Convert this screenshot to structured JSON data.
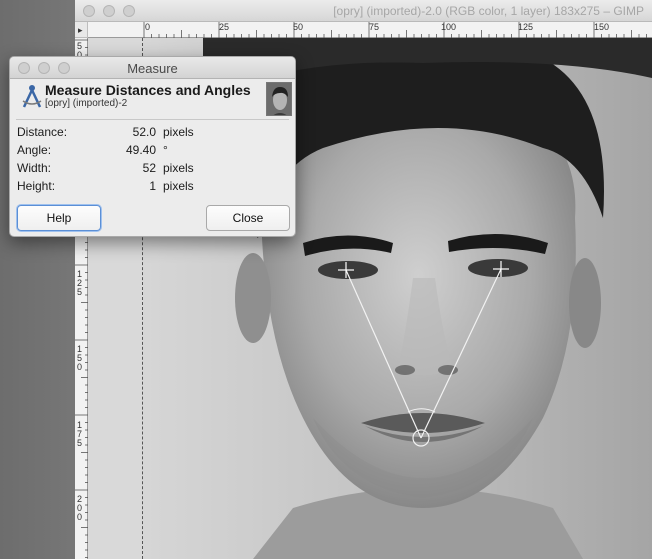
{
  "gimp_window": {
    "title": "[opry] (imported)-2.0 (RGB color, 1 layer) 183x275 – GIMP",
    "ruler_top_labels": [
      "0",
      "25",
      "50",
      "75",
      "100",
      "125",
      "150"
    ],
    "ruler_left_labels": [
      "50",
      "125",
      "150",
      "175",
      "200"
    ]
  },
  "measure_dialog": {
    "title": "Measure",
    "heading": "Measure Distances and Angles",
    "subtitle": "[opry] (imported)-2",
    "rows": [
      {
        "label": "Distance:",
        "value": "52.0",
        "unit": "pixels"
      },
      {
        "label": "Angle:",
        "value": "49.40",
        "unit": "°"
      },
      {
        "label": "Width:",
        "value": "52",
        "unit": "pixels"
      },
      {
        "label": "Height:",
        "value": "1",
        "unit": "pixels"
      }
    ],
    "help_label": "Help",
    "close_label": "Close",
    "icons": {
      "tool": "compass-measure-icon",
      "thumbnail": "image-thumbnail"
    }
  },
  "colors": {
    "focus_ring": "#5b8fd6",
    "measure_line": "#f2f2f2"
  }
}
